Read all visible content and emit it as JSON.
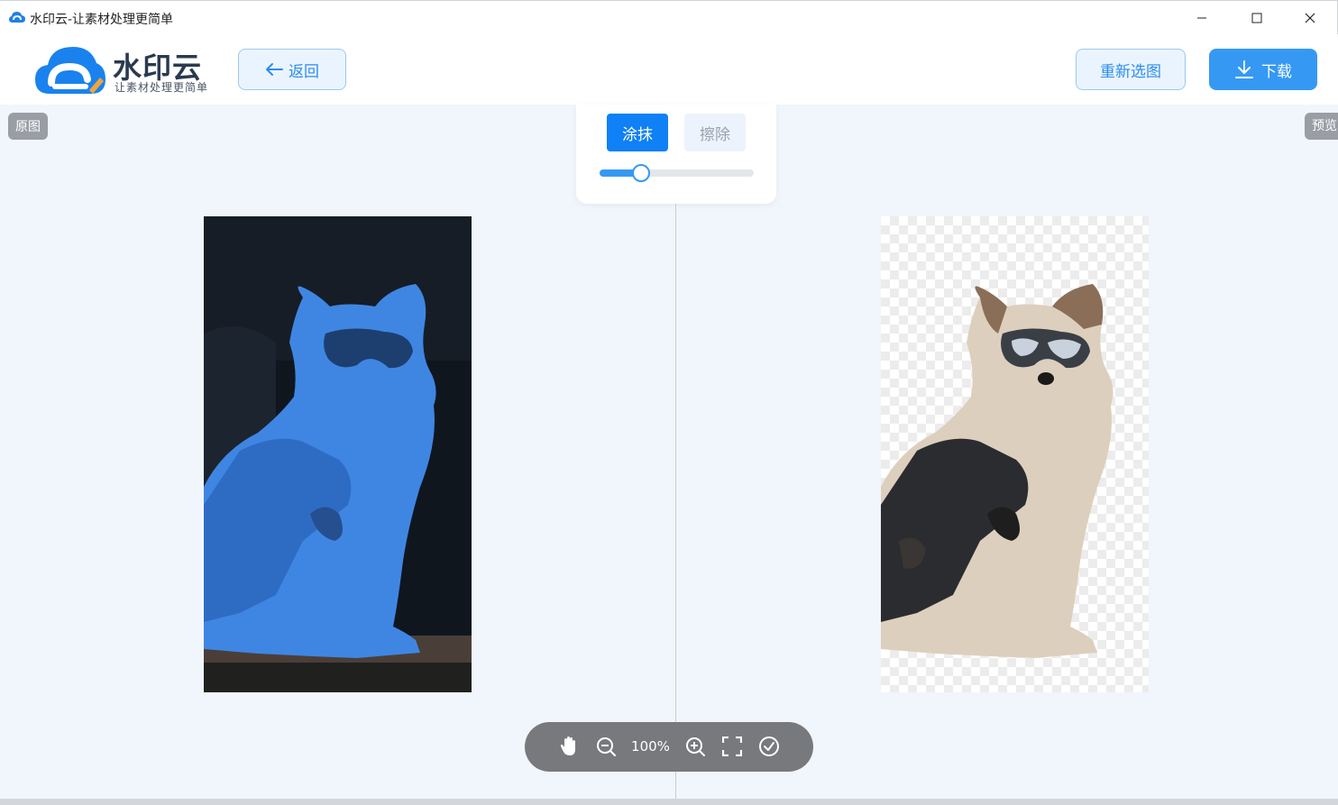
{
  "window": {
    "title": "水印云-让素材处理更简单"
  },
  "header": {
    "logo_name": "水印云",
    "logo_slogan": "让素材处理更简单",
    "back_label": "返回",
    "reselect_label": "重新选图",
    "download_label": "下载"
  },
  "labels": {
    "original": "原图",
    "preview": "预览"
  },
  "tools": {
    "smear_label": "涂抹",
    "erase_label": "擦除",
    "brush_size_percent": 27
  },
  "zoom": {
    "level": "100%"
  },
  "colors": {
    "accent": "#3599f4",
    "active_tool": "#0f80f5",
    "mask": "#3f86e3"
  },
  "icons": {
    "back": "arrow-left-icon",
    "download": "download-icon",
    "pan": "hand-icon",
    "zoom_out": "zoom-out-icon",
    "zoom_in": "zoom-in-icon",
    "fit": "fullscreen-icon",
    "confirm": "check-circle-icon"
  }
}
